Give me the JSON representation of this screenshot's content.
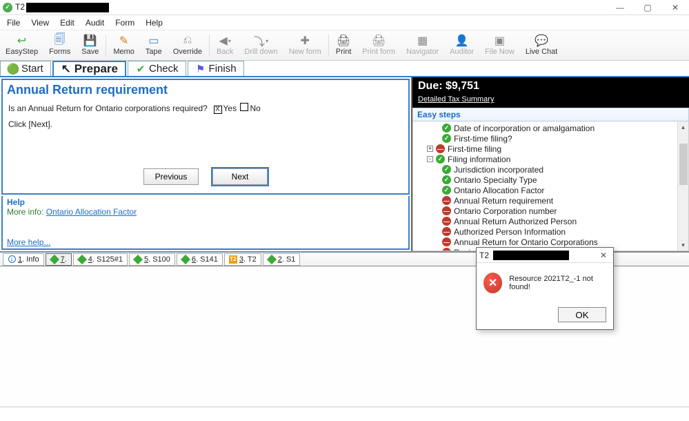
{
  "title_prefix": "T2",
  "menus": [
    "File",
    "View",
    "Edit",
    "Audit",
    "Form",
    "Help"
  ],
  "toolbar": [
    {
      "label": "EasyStep",
      "icon": "↩",
      "color": "#3aaa35"
    },
    {
      "label": "Forms",
      "icon": "🗐",
      "color": "#3b82c7"
    },
    {
      "label": "Save",
      "icon": "💾",
      "color": "#3b82c7"
    },
    {
      "label": "Memo",
      "icon": "✎",
      "color": "#d97a06"
    },
    {
      "label": "Tape",
      "icon": "▭",
      "color": "#3b82c7"
    },
    {
      "label": "Override",
      "icon": "⎌",
      "color": "#888"
    },
    {
      "label": "Back",
      "icon": "◀",
      "disabled": true,
      "drop": true
    },
    {
      "label": "Drill down",
      "icon": "⤵",
      "disabled": true,
      "drop": true
    },
    {
      "label": "New form",
      "icon": "✚",
      "disabled": true
    },
    {
      "label": "Print",
      "icon": "🖨",
      "color": "#555"
    },
    {
      "label": "Print form",
      "icon": "🖨",
      "disabled": true
    },
    {
      "label": "Navigator",
      "icon": "▦",
      "disabled": true
    },
    {
      "label": "Auditor",
      "icon": "👤",
      "disabled": true
    },
    {
      "label": "File Now",
      "icon": "▣",
      "disabled": true
    },
    {
      "label": "Live Chat",
      "icon": "💬",
      "color": "#3aaa35"
    }
  ],
  "steptabs": [
    {
      "label": "Start",
      "icon": "arrow",
      "color": "#3aaa35"
    },
    {
      "label": "Prepare",
      "icon": "cursor",
      "active": true
    },
    {
      "label": "Check",
      "icon": "check",
      "color": "#3aaa35"
    },
    {
      "label": "Finish",
      "icon": "flag",
      "color": "#5b5bd6"
    }
  ],
  "panel": {
    "title": "Annual Return requirement",
    "question": "Is an Annual Return for Ontario corporations required?",
    "opt_yes": "Yes",
    "opt_no": "No",
    "hint": "Click [Next].",
    "prev": "Previous",
    "next": "Next"
  },
  "help": {
    "title": "Help",
    "more_label": "More info:",
    "link": "Ontario Allocation Factor",
    "morehelp": "More help..."
  },
  "due": {
    "label": "Due: $9,751",
    "summary": "Detailed Tax Summary"
  },
  "tree_header": "Easy steps",
  "tree": [
    {
      "indent": 2,
      "status": "ok",
      "label": "Date of incorporation or amalgamation"
    },
    {
      "indent": 2,
      "status": "ok",
      "label": "First-time filing?"
    },
    {
      "indent": 1,
      "exp": "+",
      "status": "bad",
      "label": "First-time filing"
    },
    {
      "indent": 1,
      "exp": "-",
      "status": "ok",
      "label": "Filing information"
    },
    {
      "indent": 2,
      "status": "ok",
      "label": "Jurisdiction incorporated"
    },
    {
      "indent": 2,
      "status": "ok",
      "label": "Ontario Specialty Type"
    },
    {
      "indent": 2,
      "status": "ok",
      "label": "Ontario Allocation Factor"
    },
    {
      "indent": 2,
      "status": "bad",
      "label": "Annual Return requirement"
    },
    {
      "indent": 2,
      "status": "bad",
      "label": "Ontario Corporation number"
    },
    {
      "indent": 2,
      "status": "bad",
      "label": "Annual Return Authorized Person"
    },
    {
      "indent": 2,
      "status": "bad",
      "label": "Authorized Person Information"
    },
    {
      "indent": 2,
      "status": "bad",
      "label": "Annual Return for Ontario Corporations"
    },
    {
      "indent": 2,
      "status": "bad",
      "label": "Review corporate information"
    }
  ],
  "bottom_tabs": [
    {
      "icon": "info",
      "label": "1. Info"
    },
    {
      "icon": "diamond",
      "label": "7.",
      "active": true
    },
    {
      "icon": "diamond",
      "label": "4. S125#1"
    },
    {
      "icon": "diamond",
      "label": "5. S100"
    },
    {
      "icon": "diamond",
      "label": "6. S141"
    },
    {
      "icon": "t2",
      "label": "3. T2"
    },
    {
      "icon": "diamond",
      "label": "2. S1"
    }
  ],
  "dialog": {
    "message": "Resource 2021T2_-1 not found!",
    "ok": "OK"
  }
}
